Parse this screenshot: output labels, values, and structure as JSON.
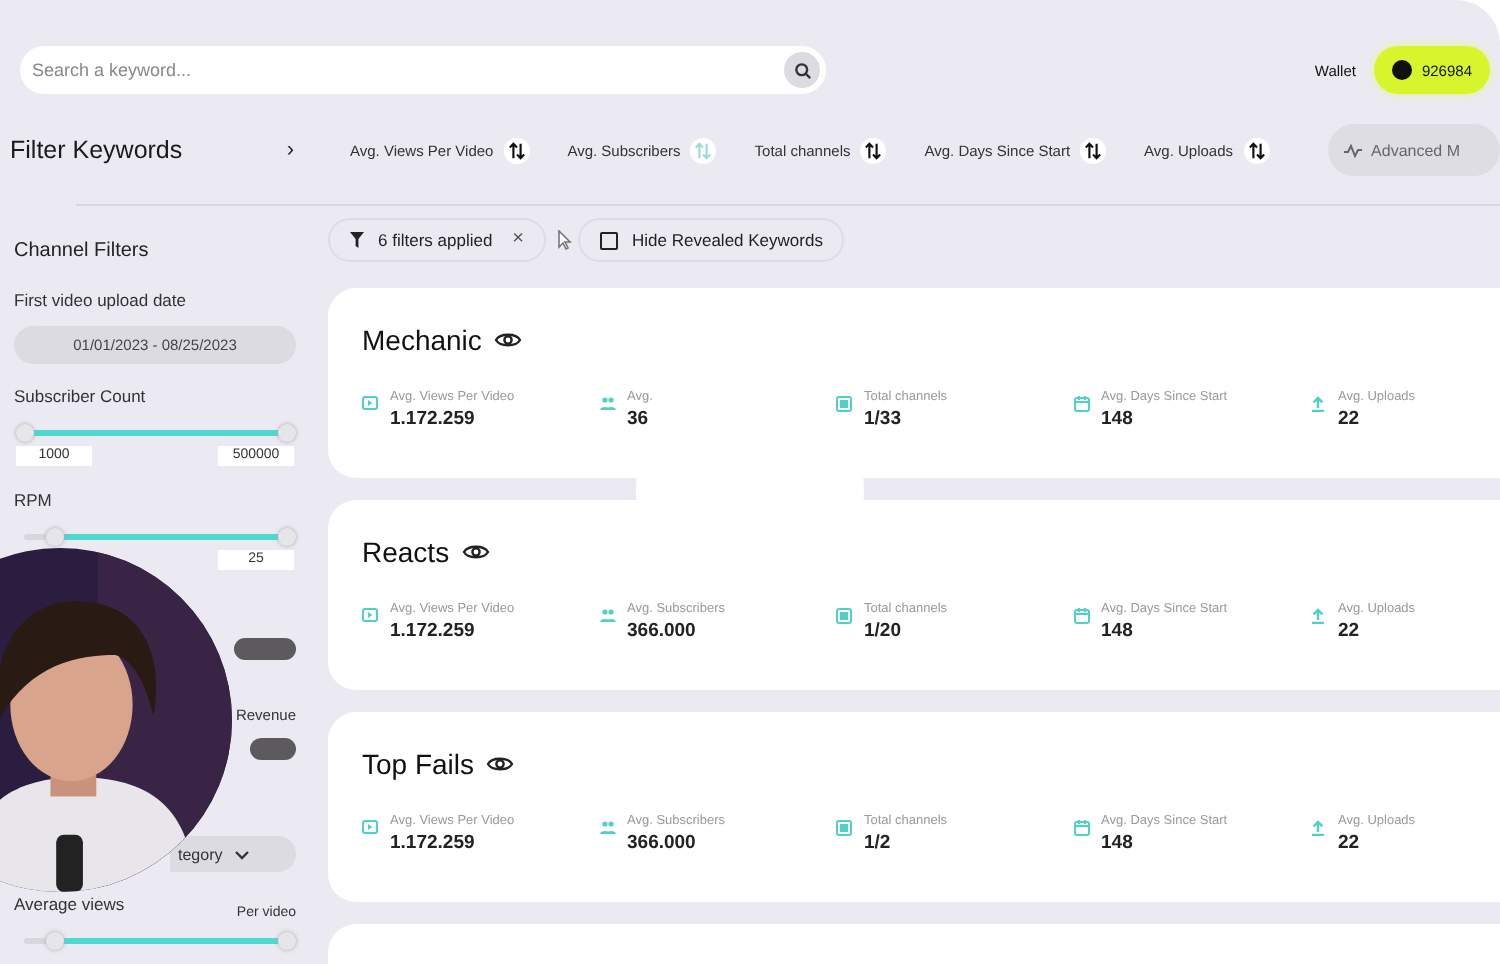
{
  "search": {
    "placeholder": "Search a keyword..."
  },
  "wallet": {
    "label": "Wallet",
    "balance": "926984"
  },
  "header": {
    "title": "Filter Keywords",
    "expand": "›",
    "advanced": "Advanced M"
  },
  "sort_columns": [
    {
      "label": "Avg. Views Per Video",
      "active": false
    },
    {
      "label": "Avg. Subscribers",
      "active": true
    },
    {
      "label": "Total channels",
      "active": false
    },
    {
      "label": "Avg. Days Since Start",
      "active": false
    },
    {
      "label": "Avg. Uploads",
      "active": false
    }
  ],
  "chips": {
    "filters": "6 filters applied",
    "clear": "×",
    "hide_revealed": {
      "label": "Hide Revealed Keywords",
      "checked": false
    }
  },
  "sidebar": [
    {
      "kind": "heading",
      "text": "Channel Filters"
    },
    {
      "kind": "label",
      "text": "First video upload date"
    },
    {
      "kind": "date",
      "text": "01/01/2023 - 08/25/2023"
    },
    {
      "kind": "label",
      "text": "Subscriber Count"
    },
    {
      "kind": "range",
      "thumbs": [
        {
          "level": 0
        },
        {
          "level": 1
        }
      ],
      "min_box": "1000",
      "max_box": "500000"
    },
    {
      "kind": "label",
      "text": "RPM"
    },
    {
      "kind": "range",
      "thumbs": [
        {
          "level": 0.12
        },
        {
          "level": 1
        }
      ],
      "max_box": "25"
    },
    {
      "kind": "dark-bar"
    },
    {
      "kind": "side-label",
      "text": "Revenue"
    },
    {
      "kind": "dark-bar"
    },
    {
      "kind": "dropdown",
      "text": "tegory"
    },
    {
      "kind": "label-row",
      "text": "Average views",
      "note": "Per video"
    },
    {
      "kind": "range",
      "thumbs": [
        {
          "level": 0.12
        },
        {
          "level": 1
        }
      ]
    }
  ],
  "cards": [
    {
      "title": "Mechanic",
      "stats": [
        {
          "label": "Avg. Views Per Video",
          "value": "1.172.259"
        },
        {
          "label": "Avg.",
          "value": "36"
        },
        {
          "label": "Total channels",
          "value": "1/33"
        },
        {
          "label": "Avg. Days Since Start",
          "value": "148"
        },
        {
          "label": "Avg. Uploads",
          "value": "22"
        }
      ]
    },
    {
      "title": "Reacts",
      "stats": [
        {
          "label": "Avg. Views Per Video",
          "value": "1.172.259"
        },
        {
          "label": "Avg. Subscribers",
          "value": "366.000"
        },
        {
          "label": "Total channels",
          "value": "1/20"
        },
        {
          "label": "Avg. Days Since Start",
          "value": "148"
        },
        {
          "label": "Avg. Uploads",
          "value": "22"
        }
      ]
    },
    {
      "title": "Top Fails",
      "stats": [
        {
          "label": "Avg. Views Per Video",
          "value": "1.172.259"
        },
        {
          "label": "Avg. Subscribers",
          "value": "366.000"
        },
        {
          "label": "Total channels",
          "value": "1/2"
        },
        {
          "label": "Avg. Days Since Start",
          "value": "148"
        },
        {
          "label": "Avg. Uploads",
          "value": "22"
        }
      ]
    }
  ],
  "partial_card_below": true,
  "play_overlay": true
}
